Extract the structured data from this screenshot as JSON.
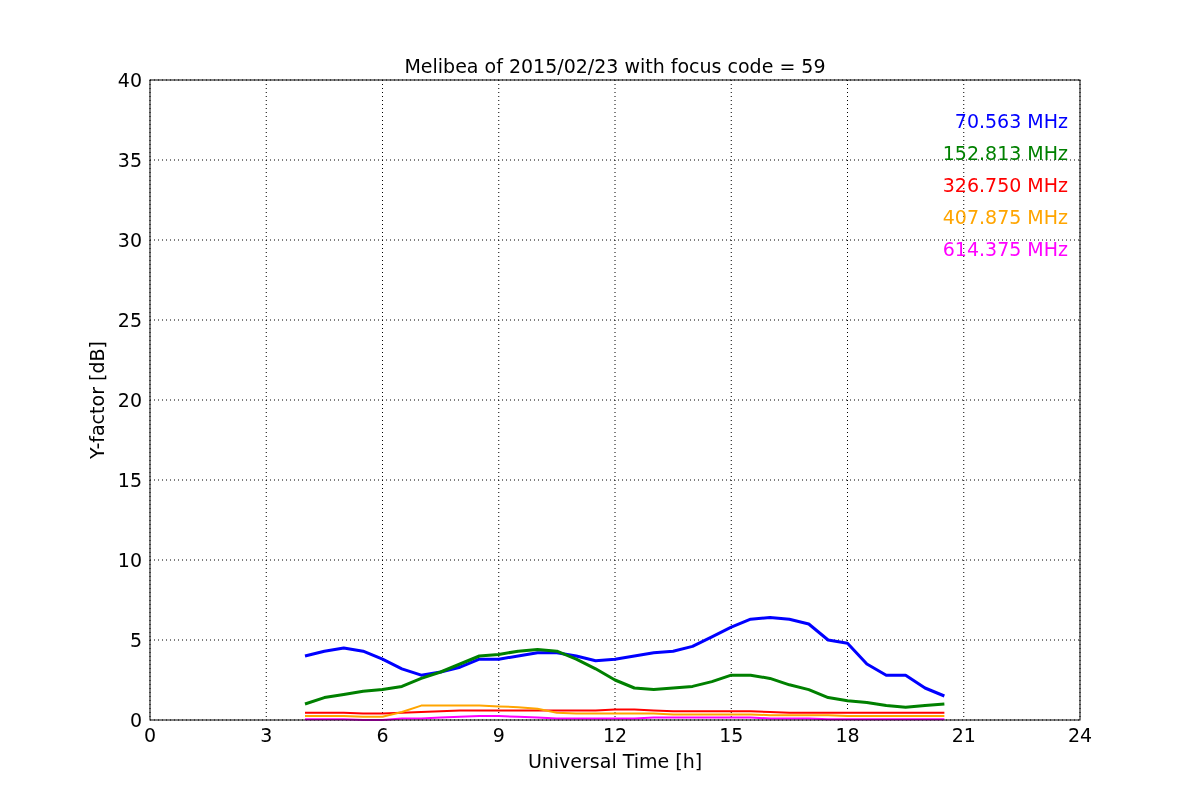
{
  "chart_data": {
    "type": "line",
    "title": "Melibea of 2015/02/23 with focus code = 59",
    "xlabel": "Universal Time [h]",
    "ylabel": "Y-factor [dB]",
    "xlim": [
      0,
      24
    ],
    "ylim": [
      0,
      40
    ],
    "xticks": [
      0,
      3,
      6,
      9,
      12,
      15,
      18,
      21,
      24
    ],
    "yticks": [
      0,
      5,
      10,
      15,
      20,
      25,
      30,
      35,
      40
    ],
    "grid": true,
    "x": [
      4,
      4.5,
      5,
      5.5,
      6,
      6.5,
      7,
      7.5,
      8,
      8.5,
      9,
      9.5,
      10,
      10.5,
      11,
      11.5,
      12,
      12.5,
      13,
      13.5,
      14,
      14.5,
      15,
      15.5,
      16,
      16.5,
      17,
      17.5,
      18,
      18.5,
      19,
      19.5,
      20,
      20.5
    ],
    "series": [
      {
        "name": "70.563 MHz",
        "color": "#0000ff",
        "values": [
          4.0,
          4.3,
          4.5,
          4.3,
          3.8,
          3.2,
          2.8,
          3.0,
          3.3,
          3.8,
          3.8,
          4.0,
          4.2,
          4.2,
          4.0,
          3.7,
          3.8,
          4.0,
          4.2,
          4.3,
          4.6,
          5.2,
          5.8,
          6.3,
          6.4,
          6.3,
          6.0,
          5.0,
          4.8,
          3.5,
          2.8,
          2.8,
          2.0,
          1.5
        ]
      },
      {
        "name": "152.813 MHz",
        "color": "#008000",
        "values": [
          1.0,
          1.4,
          1.6,
          1.8,
          1.9,
          2.1,
          2.6,
          3.0,
          3.5,
          4.0,
          4.1,
          4.3,
          4.4,
          4.3,
          3.8,
          3.2,
          2.5,
          2.0,
          1.9,
          2.0,
          2.1,
          2.4,
          2.8,
          2.8,
          2.6,
          2.2,
          1.9,
          1.4,
          1.2,
          1.1,
          0.9,
          0.8,
          0.9,
          1.0
        ]
      },
      {
        "name": "326.750 MHz",
        "color": "#ff0000",
        "values": [
          0.45,
          0.45,
          0.45,
          0.4,
          0.4,
          0.45,
          0.5,
          0.55,
          0.6,
          0.6,
          0.6,
          0.6,
          0.6,
          0.6,
          0.6,
          0.6,
          0.65,
          0.65,
          0.6,
          0.55,
          0.55,
          0.55,
          0.55,
          0.55,
          0.5,
          0.45,
          0.45,
          0.45,
          0.45,
          0.45,
          0.45,
          0.45,
          0.45,
          0.45
        ]
      },
      {
        "name": "407.875 MHz",
        "color": "#ffa500",
        "values": [
          0.25,
          0.25,
          0.25,
          0.2,
          0.2,
          0.5,
          0.9,
          0.9,
          0.9,
          0.9,
          0.85,
          0.8,
          0.7,
          0.45,
          0.4,
          0.4,
          0.4,
          0.4,
          0.4,
          0.35,
          0.35,
          0.35,
          0.35,
          0.35,
          0.3,
          0.3,
          0.3,
          0.3,
          0.25,
          0.25,
          0.25,
          0.25,
          0.25,
          0.25
        ]
      },
      {
        "name": "614.375 MHz",
        "color": "#ff00ff",
        "values": [
          0.05,
          0.05,
          0.05,
          0.0,
          0.0,
          0.1,
          0.1,
          0.15,
          0.2,
          0.25,
          0.25,
          0.2,
          0.15,
          0.1,
          0.1,
          0.1,
          0.1,
          0.1,
          0.15,
          0.15,
          0.15,
          0.15,
          0.15,
          0.15,
          0.1,
          0.1,
          0.1,
          0.05,
          0.05,
          0.05,
          0.05,
          0.05,
          0.05,
          0.05
        ]
      }
    ]
  }
}
